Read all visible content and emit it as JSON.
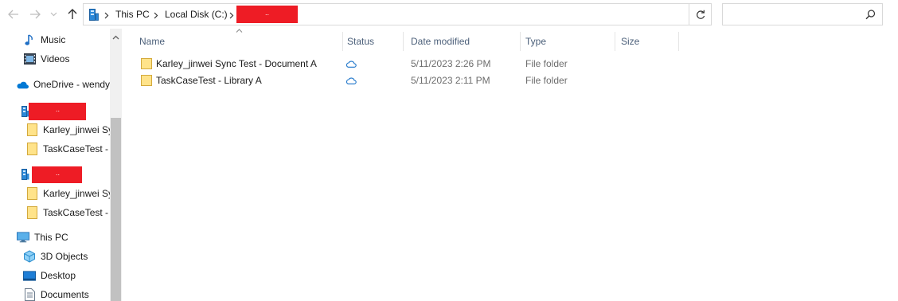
{
  "nav": {
    "back_icon": "arrow-left-icon",
    "forward_icon": "arrow-right-icon",
    "recent_icon": "chevron-down-icon",
    "up_icon": "arrow-up-icon"
  },
  "address": {
    "icon": "this-pc-icon",
    "crumbs": [
      "This PC",
      "Local Disk (C:)",
      ".."
    ],
    "refresh_icon": "refresh-icon"
  },
  "search": {
    "value": "",
    "placeholder": "",
    "icon": "search-icon"
  },
  "sidebar": {
    "items": [
      {
        "label": "Music",
        "icon": "music-icon"
      },
      {
        "label": "Videos",
        "icon": "videos-icon"
      },
      {
        "label": "OneDrive - wendy",
        "icon": "onedrive-cloud-icon"
      },
      {
        "label": "..",
        "icon": "sharepoint-site-icon"
      },
      {
        "label": "Karley_jinwei Syn",
        "icon": "folder-icon"
      },
      {
        "label": "TaskCaseTest - Li",
        "icon": "folder-icon"
      },
      {
        "label": "..",
        "icon": "sharepoint-site-icon"
      },
      {
        "label": "Karley_jinwei Sync",
        "icon": "folder-icon"
      },
      {
        "label": "TaskCaseTest - Li",
        "icon": "folder-icon"
      },
      {
        "label": "This PC",
        "icon": "this-pc-icon"
      },
      {
        "label": "3D Objects",
        "icon": "3d-objects-icon"
      },
      {
        "label": "Desktop",
        "icon": "desktop-icon"
      },
      {
        "label": "Documents",
        "icon": "documents-icon"
      }
    ]
  },
  "columns": {
    "name": "Name",
    "status": "Status",
    "date_modified": "Date modified",
    "type": "Type",
    "size": "Size"
  },
  "files": [
    {
      "name": "Karley_jinwei Sync Test - Document A",
      "status_icon": "cloud-status-icon",
      "date": "5/11/2023 2:26 PM",
      "type": "File folder",
      "size": ""
    },
    {
      "name": "TaskCaseTest - Library A",
      "status_icon": "cloud-status-icon",
      "date": "5/11/2023 2:11 PM",
      "type": "File folder",
      "size": ""
    }
  ],
  "colors": {
    "redaction": "#ee1c25",
    "folder": "#ffd767",
    "onedrive_blue": "#0078d4",
    "header_text": "#4c607a"
  }
}
